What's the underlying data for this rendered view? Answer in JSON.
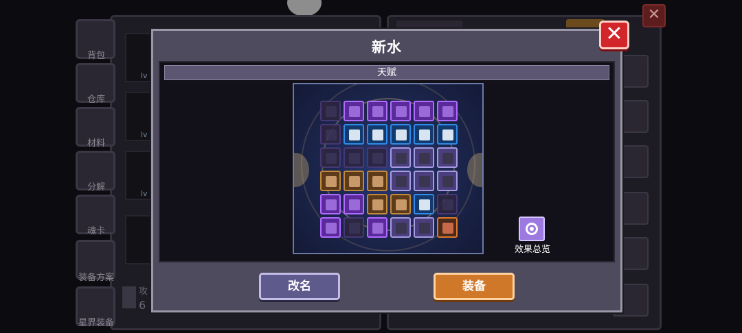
{
  "background": {
    "sidebar": [
      "背包",
      "仓库",
      "材料",
      "分解",
      "魂卡",
      "装备方案",
      "星界装备"
    ],
    "level_tags": [
      "lv",
      "lv",
      "lv"
    ],
    "stat_label": "攻",
    "stat_value": "6"
  },
  "dialog": {
    "title": "新水",
    "section_title": "天赋",
    "summary_label": "效果总览",
    "rename_label": "改名",
    "equip_label": "装备",
    "close_symbol": "✕"
  },
  "talent_board": {
    "rows": 6,
    "cols": 6,
    "node_types": [
      [
        "dim",
        "purple",
        "purple",
        "purple",
        "purple",
        "purple"
      ],
      [
        "dim",
        "blue",
        "blue",
        "blue",
        "blue",
        "blue"
      ],
      [
        "dim",
        "dim",
        "dim",
        "lavender",
        "lavender",
        "lavender"
      ],
      [
        "gold",
        "gold",
        "gold",
        "lavender",
        "lavender",
        "lavender"
      ],
      [
        "purple",
        "purple",
        "gold",
        "gold",
        "blue",
        "dim"
      ],
      [
        "purple",
        "dim",
        "purple",
        "lavender",
        "lavender",
        "orange"
      ]
    ]
  },
  "colors": {
    "dialog_bg": "#4f4b5e",
    "close_red": "#d3262b",
    "equip_orange": "#d0782a",
    "rename_purple": "#5f5a8c"
  }
}
